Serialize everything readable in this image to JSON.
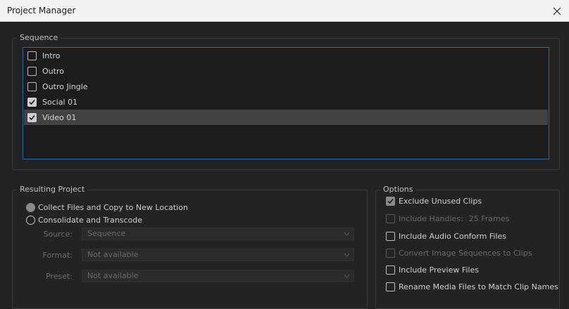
{
  "window": {
    "title": "Project Manager"
  },
  "sequence": {
    "group_label": "Sequence",
    "items": [
      {
        "label": "Intro",
        "checked": false,
        "selected": false
      },
      {
        "label": "Outro",
        "checked": false,
        "selected": false
      },
      {
        "label": "Outro Jingle",
        "checked": false,
        "selected": false
      },
      {
        "label": "Social 01",
        "checked": true,
        "selected": false
      },
      {
        "label": "Video 01",
        "checked": true,
        "selected": true
      }
    ]
  },
  "resulting_project": {
    "group_label": "Resulting Project",
    "collect_label": "Collect Files and Copy to New Location",
    "consolidate_label": "Consolidate and Transcode",
    "source_label": "Source:",
    "source_value": "Sequence",
    "format_label": "Format:",
    "format_value": "Not available",
    "preset_label": "Preset:",
    "preset_value": "Not available"
  },
  "options": {
    "group_label": "Options",
    "exclude_unused": "Exclude Unused Clips",
    "include_handles": "Include Handles:",
    "handles_value": "25 Frames",
    "include_audio_conform": "Include Audio Conform Files",
    "convert_image_sequences": "Convert Image Sequences to Clips",
    "include_preview": "Include Preview Files",
    "rename_media": "Rename Media Files to Match Clip Names"
  },
  "colors": {
    "accent_border": "#2d6aa5",
    "selected_row": "#424242",
    "background": "#232323"
  },
  "icons": [
    "close-icon",
    "checkmark-icon",
    "chevron-down-icon"
  ]
}
